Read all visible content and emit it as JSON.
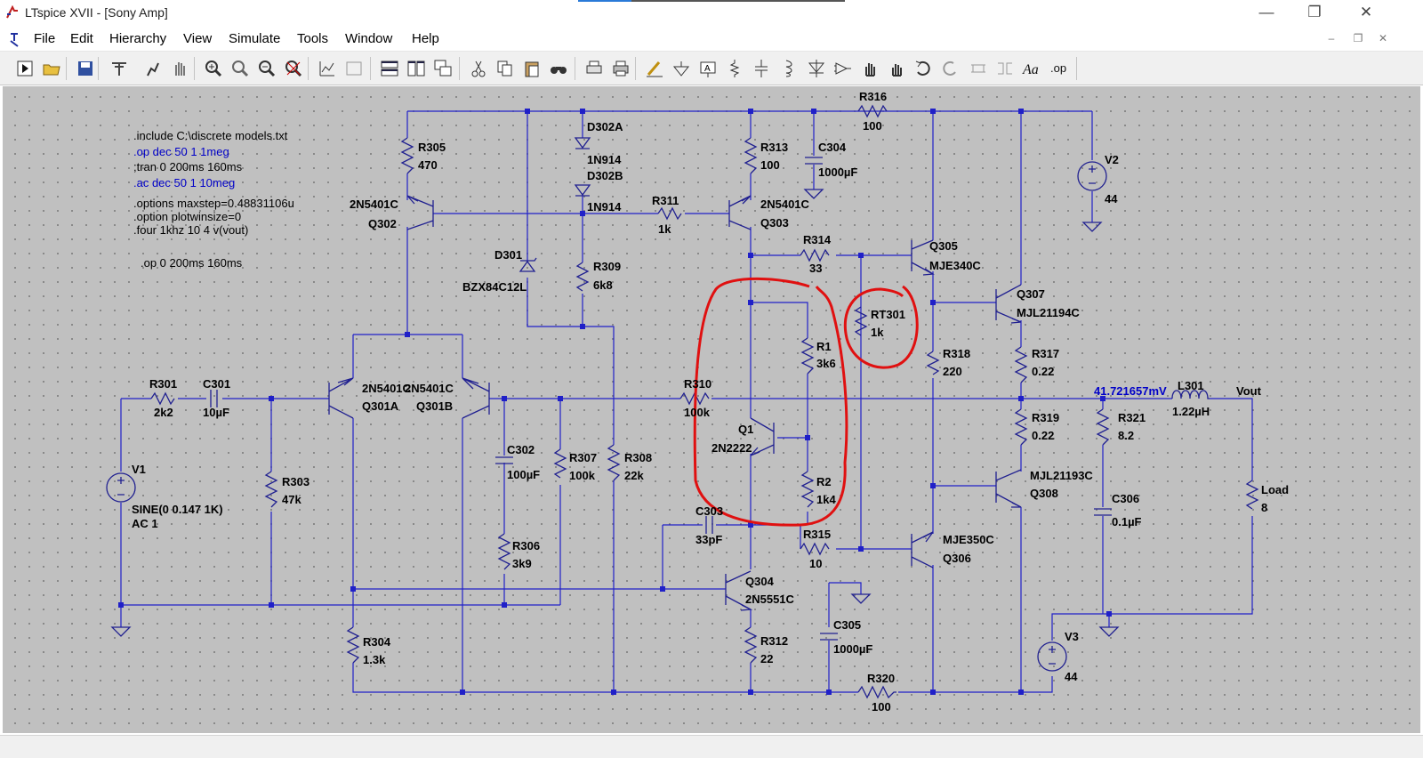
{
  "window": {
    "title": "LTspice XVII - [Sony Amp]"
  },
  "menu": [
    "File",
    "Edit",
    "Hierarchy",
    "View",
    "Simulate",
    "Tools",
    "Window",
    "Help"
  ],
  "toolbar_icons": [
    "run-icon",
    "open-icon",
    "save-icon",
    "control-panel-icon",
    "halt-icon",
    "pan-icon",
    "zoom-in-icon",
    "zoom-area-icon",
    "zoom-out-icon",
    "zoom-fit-icon",
    "autorange-icon",
    "view-icon",
    "tile-horizontal-icon",
    "tile-vertical-icon",
    "cascade-icon",
    "cut-icon",
    "copy-icon",
    "paste-icon",
    "find-icon",
    "print-preview-icon",
    "print-icon",
    "draw-wire-icon",
    "ground-icon",
    "label-net-icon",
    "resistor-icon",
    "capacitor-icon",
    "inductor-icon",
    "diode-icon",
    "component-icon",
    "move-icon",
    "drag-icon",
    "undo-icon",
    "redo-icon",
    "rotate-icon",
    "mirror-icon",
    "text-icon",
    "spice-directive-icon"
  ],
  "directives": {
    "d1": ".include C:\\discrete models.txt",
    "d2": ".op dec 50 1 1meg",
    "d3": ";tran 0 200ms 160ms",
    "d4": ".ac dec 50 1 10meg",
    "d5": ".options maxstep=0.48831106u",
    "d6": ".option plotwinsize=0",
    "d7": ".four 1khz 10 4 v(vout)",
    "d8": ".op 0 200ms 160ms"
  },
  "labels": {
    "R316": "R316",
    "R316v": "100",
    "R305": "R305",
    "R305v": "470",
    "D302A": "D302A",
    "D302Av": "1N914",
    "D302B": "D302B",
    "D302Bv": "1N914",
    "R313": "R313",
    "R313v": "100",
    "C304": "C304",
    "C304v": "1000µF",
    "V2": "V2",
    "V2v": "44",
    "Q302t": "2N5401C",
    "Q302": "Q302",
    "R311": "R311",
    "R311v": "1k",
    "Q303t": "2N5401C",
    "Q303": "Q303",
    "R314": "R314",
    "R314v": "33",
    "Q305": "Q305",
    "Q305t": "MJE340C",
    "D301": "D301",
    "D301v": "BZX84C12L",
    "R309": "R309",
    "R309v": "6k8",
    "Q307": "Q307",
    "Q307t": "MJL21194C",
    "RT301": "RT301",
    "RT301v": "1k",
    "R1": "R1",
    "R1v": "3k6",
    "R318": "R318",
    "R318v": "220",
    "R317": "R317",
    "R317v": "0.22",
    "R301": "R301",
    "R301v": "2k2",
    "C301": "C301",
    "C301v": "10µF",
    "Q301At": "2N5401C",
    "Q301Bt": "2N5401C",
    "Q301A": "Q301A",
    "Q301B": "Q301B",
    "R310": "R310",
    "R310v": "100k",
    "vout_probe": "41.721657mV",
    "L301": "L301",
    "L301v": "1.22µH",
    "Vout": "Vout",
    "R319": "R319",
    "R319v": "0.22",
    "R321": "R321",
    "R321v": "8.2",
    "Q1": "Q1",
    "Q1t": "2N2222",
    "C302": "C302",
    "C302v": "100µF",
    "R307": "R307",
    "R307v": "100k",
    "R308": "R308",
    "R308v": "22k",
    "Q308t": "MJL21193C",
    "Q308": "Q308",
    "V1": "V1",
    "V1s": "SINE(0 0.147 1K)",
    "V1a": "AC 1",
    "R303": "R303",
    "R303v": "47k",
    "R2": "R2",
    "R2v": "1k4",
    "Load": "Load",
    "Loadv": "8",
    "C306": "C306",
    "C306v": "0.1µF",
    "C303": "C303",
    "C303v": "33pF",
    "R315": "R315",
    "R315v": "10",
    "Q306t": "MJE350C",
    "Q306": "Q306",
    "R306": "R306",
    "R306v": "3k9",
    "Q304": "Q304",
    "Q304t": "2N5551C",
    "C305": "C305",
    "C305v": "1000µF",
    "V3": "V3",
    "V3v": "44",
    "R304": "R304",
    "R304v": "1.3k",
    "R312": "R312",
    "R312v": "22",
    "R320": "R320",
    "R320v": "100"
  },
  "colors": {
    "wire": "#2020c8",
    "component": "#202090",
    "annotation": "#e01010",
    "canvas": "#c0c0c0",
    "label": "#000000",
    "directive_active": "#0000c8",
    "probe": "#0000c8"
  }
}
